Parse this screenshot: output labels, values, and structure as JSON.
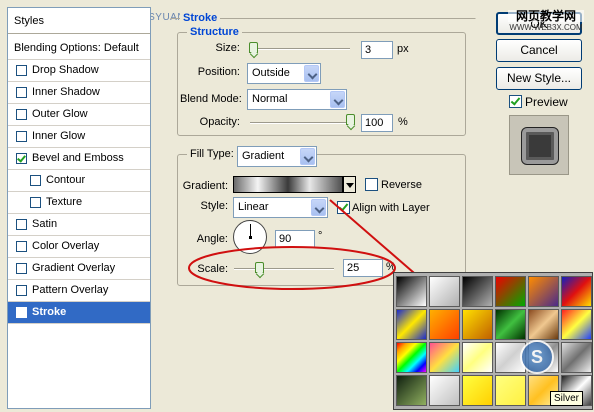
{
  "watermark_top": "思缘设计论坛 WWW.MISSYUAN.COM",
  "sidebar": {
    "header": "Styles",
    "blending": "Blending Options: Default",
    "items": [
      {
        "label": "Drop Shadow",
        "checked": false
      },
      {
        "label": "Inner Shadow",
        "checked": false
      },
      {
        "label": "Outer Glow",
        "checked": false
      },
      {
        "label": "Inner Glow",
        "checked": false
      },
      {
        "label": "Bevel and Emboss",
        "checked": true
      },
      {
        "label": "Contour",
        "checked": false
      },
      {
        "label": "Texture",
        "checked": false
      },
      {
        "label": "Satin",
        "checked": false
      },
      {
        "label": "Color Overlay",
        "checked": false
      },
      {
        "label": "Gradient Overlay",
        "checked": false
      },
      {
        "label": "Pattern Overlay",
        "checked": false
      },
      {
        "label": "Stroke",
        "checked": true
      }
    ]
  },
  "stroke": {
    "title": "Stroke",
    "structure": {
      "title": "Structure",
      "size_label": "Size:",
      "size_value": "3",
      "size_unit": "px",
      "position_label": "Position:",
      "position_value": "Outside",
      "blend_label": "Blend Mode:",
      "blend_value": "Normal",
      "opacity_label": "Opacity:",
      "opacity_value": "100",
      "opacity_unit": "%",
      "size_level": 0.03,
      "opacity_level": 1.0
    },
    "fill_type_label": "Fill Type:",
    "fill_type_value": "Gradient",
    "gradient_label": "Gradient:",
    "reverse_label": "Reverse",
    "reverse_checked": false,
    "style_label": "Style:",
    "style_value": "Linear",
    "align_label": "Align with Layer",
    "align_checked": true,
    "angle_label": "Angle:",
    "angle_value": "90",
    "angle_unit": "°",
    "scale_label": "Scale:",
    "scale_value": "25",
    "scale_unit": "%",
    "scale_level": 0.25
  },
  "buttons": {
    "ok": "OK",
    "cancel": "Cancel",
    "new_style": "New Style...",
    "preview_label": "Preview",
    "preview_checked": true
  },
  "watermark_right": {
    "line1": "网页教学网",
    "line2": "WWW.WEB3X.COM"
  },
  "gradient_picker": {
    "tooltip": "Silver",
    "swatches": [
      "linear-gradient(135deg,#000,#fff)",
      "linear-gradient(135deg,#fff,rgba(255,255,255,0))",
      "linear-gradient(135deg,#000,rgba(0,0,0,0))",
      "linear-gradient(135deg,#e00,#0a0)",
      "linear-gradient(135deg,#ff8c00,#4a2a8a)",
      "linear-gradient(135deg,#1020c0,#e01010,#ffe000)",
      "linear-gradient(135deg,#1a2ad0,#ffe800,#1a2ad0)",
      "linear-gradient(135deg,#ffb000,#ff4000)",
      "linear-gradient(135deg,#ffe000,#c06000)",
      "linear-gradient(135deg,#003000,#40c040,#003000)",
      "linear-gradient(135deg,#8a4b20,#f0c890,#6a3a10)",
      "linear-gradient(135deg,#ff2020,#ffff40,#2040ff)",
      "linear-gradient(135deg,red,orange,yellow,lime,cyan,blue,magenta)",
      "linear-gradient(135deg,#ff5090,#ffe040,#40d0ff)",
      "linear-gradient(135deg,#ffffff,#ffff80,#ffffff)",
      "linear-gradient(135deg,#ffffff,#d0d0d0,#ffffff)",
      "linear-gradient(135deg,#ffffff,#909090,#ffffff)",
      "linear-gradient(135deg,#e0e0e0,#707070,#f0f0f0)",
      "linear-gradient(135deg,#102010,#90b060)",
      "linear-gradient(135deg,#ffffff,#c0c0c0)",
      "linear-gradient(135deg,#ffff40,#ffd000)",
      "linear-gradient(135deg,#ffff80,#fff040)",
      "linear-gradient(135deg,#ffe080,#ffc020,#fff0a0)",
      "linear-gradient(135deg,#202020,#ffffff,#404040)"
    ]
  },
  "colors": {
    "accent": "#316ac5",
    "group_title": "#0046d5",
    "annotation_red": "#d01010",
    "dialog_bg": "#ece9d8"
  }
}
